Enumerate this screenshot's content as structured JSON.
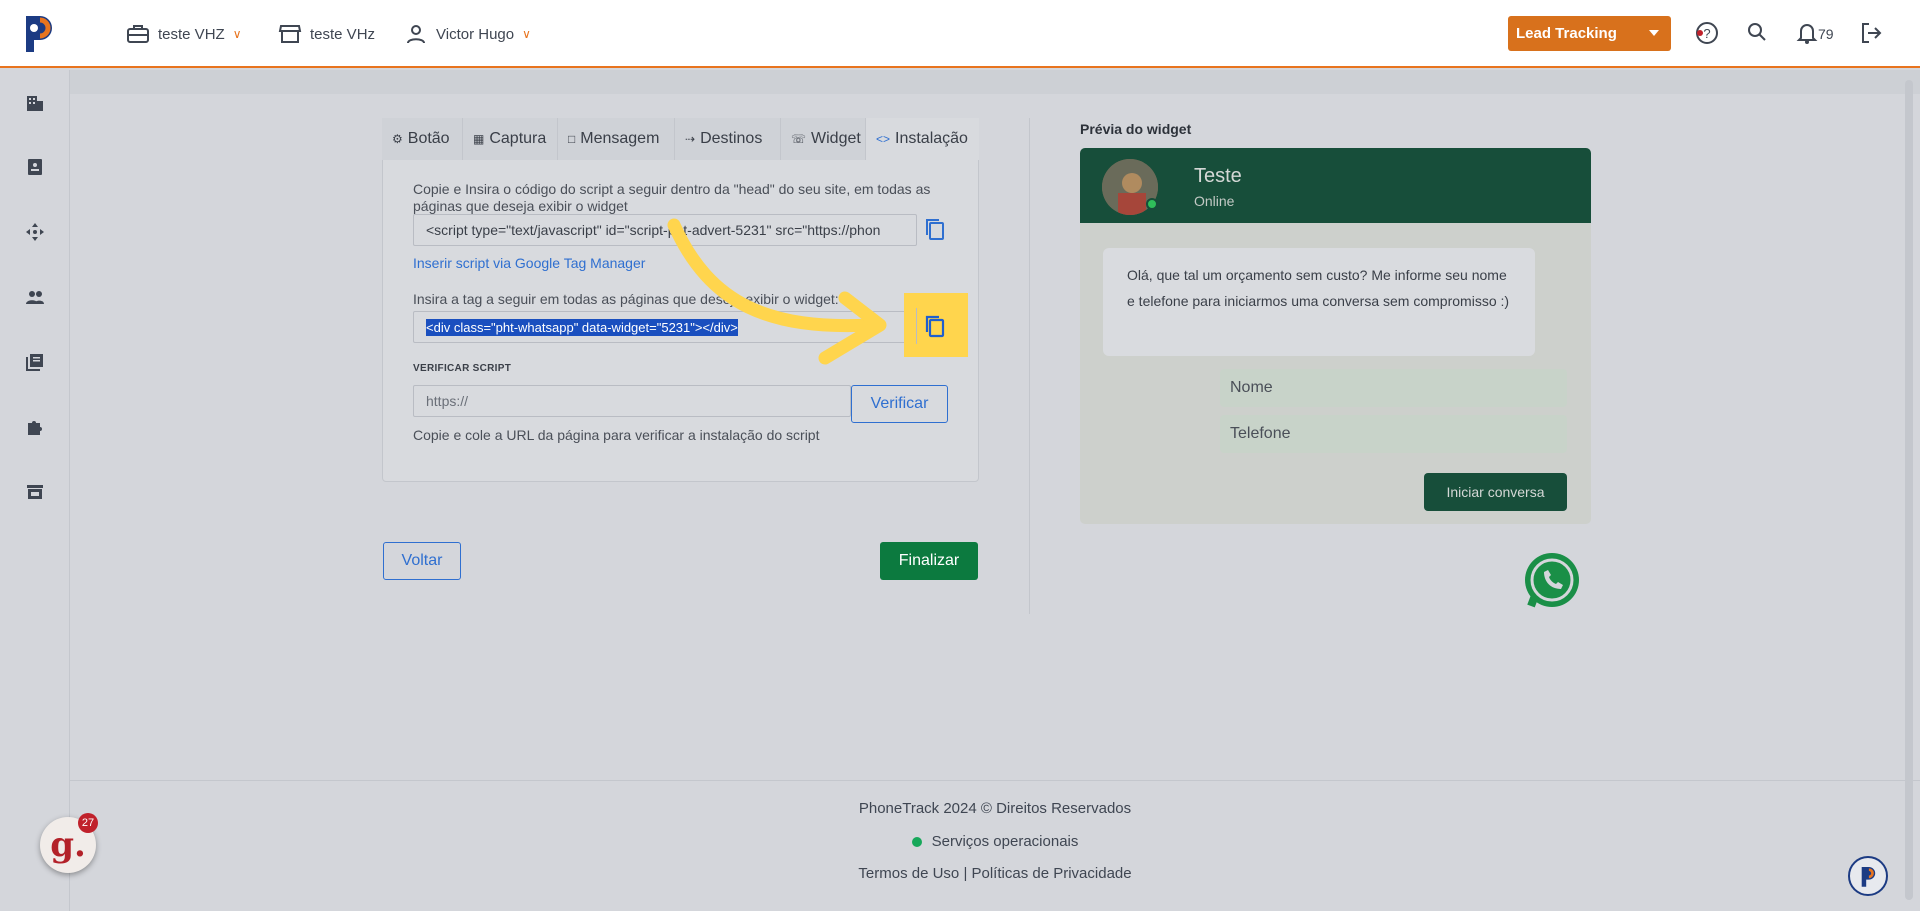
{
  "topbar": {
    "company": "teste VHZ",
    "store": "teste VHz",
    "user": "Victor Hugo",
    "lead_tracking_label": "Lead Tracking",
    "notification_count": "79"
  },
  "tabs": [
    {
      "label": "Botão",
      "icon": "gear-icon"
    },
    {
      "label": "Captura",
      "icon": "grid-icon"
    },
    {
      "label": "Mensagem",
      "icon": "message-icon"
    },
    {
      "label": "Destinos",
      "icon": "destinations-icon"
    },
    {
      "label": "Widget",
      "icon": "whatsapp-icon"
    },
    {
      "label": "Instalação",
      "icon": "code-icon"
    }
  ],
  "install": {
    "script_instructions": "Copie e Insira o código do script a seguir dentro da \"head\" do seu site, em todas as páginas que deseja exibir o widget",
    "script_code": "<script type=\"text/javascript\" id=\"script-pht-advert-5231\" src=\"https://phon",
    "gtm_link": "Inserir script via Google Tag Manager",
    "tag_instructions": "Insira a tag a seguir em todas as páginas que deseja exibir o widget:",
    "tag_code": "<div class=\"pht-whatsapp\" data-widget=\"5231\"></div>",
    "verify_heading": "VERIFICAR SCRIPT",
    "verify_placeholder": "https://",
    "verify_button": "Verificar",
    "verify_help": "Copie e cole a URL da página para verificar a instalação do script"
  },
  "actions": {
    "back": "Voltar",
    "finish": "Finalizar"
  },
  "preview": {
    "label": "Prévia do widget",
    "name": "Teste",
    "status": "Online",
    "message": "Olá, que tal um orçamento sem custo? Me informe seu nome e telefone para iniciarmos uma conversa sem compromisso :)",
    "name_placeholder": "Nome",
    "phone_placeholder": "Telefone",
    "start_button": "Iniciar conversa"
  },
  "footer": {
    "copyright": "PhoneTrack 2024 © Direitos Reservados",
    "status": "Serviços operacionais",
    "links": "Termos de Uso | Políticas de Privacidade"
  },
  "badges": {
    "g_count": "27"
  },
  "colors": {
    "accent": "#e8741e",
    "primary": "#2f6fd0",
    "success": "#0c7a3f",
    "whatsapp_dark": "#174e3a",
    "highlight": "#ffd54d"
  }
}
